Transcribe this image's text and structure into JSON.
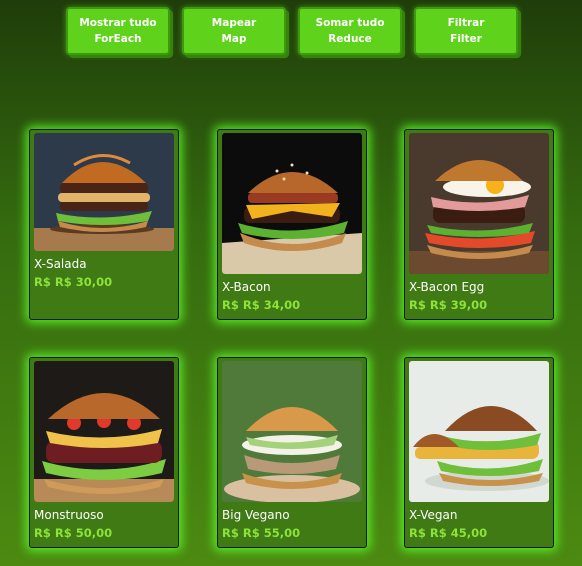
{
  "buttons": [
    {
      "line1": "Mostrar tudo",
      "line2": "ForEach"
    },
    {
      "line1": "Mapear",
      "line2": "Map"
    },
    {
      "line1": "Somar tudo",
      "line2": "Reduce"
    },
    {
      "line1": "Filtrar",
      "line2": "Filter"
    }
  ],
  "products": [
    {
      "name": "X-Salada",
      "price": "R$ R$ 30,00"
    },
    {
      "name": "X-Bacon",
      "price": "R$ R$ 34,00"
    },
    {
      "name": "X-Bacon Egg",
      "price": "R$ R$ 39,00"
    },
    {
      "name": "Monstruoso",
      "price": "R$ R$ 50,00"
    },
    {
      "name": "Big Vegano",
      "price": "R$ R$ 55,00"
    },
    {
      "name": "X-Vegan",
      "price": "R$ R$ 45,00"
    }
  ]
}
